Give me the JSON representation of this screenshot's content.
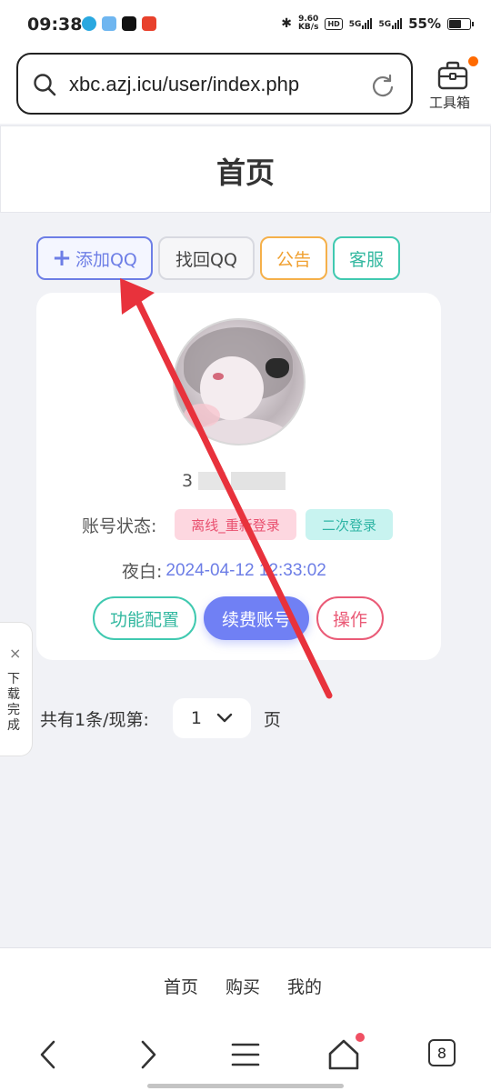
{
  "status_bar": {
    "time": "09:38",
    "speed": "9.60\nKB/s",
    "net1": "5G",
    "net2": "5G",
    "battery": "55%"
  },
  "browser": {
    "url": "xbc.azj.icu/user/index.php",
    "toolbox_label": "工具箱"
  },
  "page": {
    "title": "首页"
  },
  "top_buttons": {
    "add_qq": "添加QQ",
    "find_qq": "找回QQ",
    "notice": "公告",
    "service": "客服"
  },
  "account_card": {
    "qq_number_visible": "3",
    "status_label": "账号状态:",
    "status_offline": "离线_重新登录",
    "status_second_login": "二次登录",
    "name_label": "夜白:",
    "timestamp": "2024-04-12 12:33:02",
    "config_button": "功能配置",
    "renew_button": "续费账号",
    "action_button": "操作"
  },
  "pagination": {
    "summary": "共有1条/现第:",
    "current_page": "1",
    "page_suffix": "页"
  },
  "download_panel": {
    "close": "×",
    "label": "下载完成"
  },
  "site_nav": {
    "items": [
      "首页",
      "购买",
      "我的"
    ]
  },
  "browser_bar": {
    "tab_count": "8"
  },
  "colors": {
    "accent_blue": "#6d7ee6",
    "teal": "#33b8a0",
    "orange": "#f0a030",
    "pink": "#e9506f",
    "annotation_red": "#e8323c"
  }
}
